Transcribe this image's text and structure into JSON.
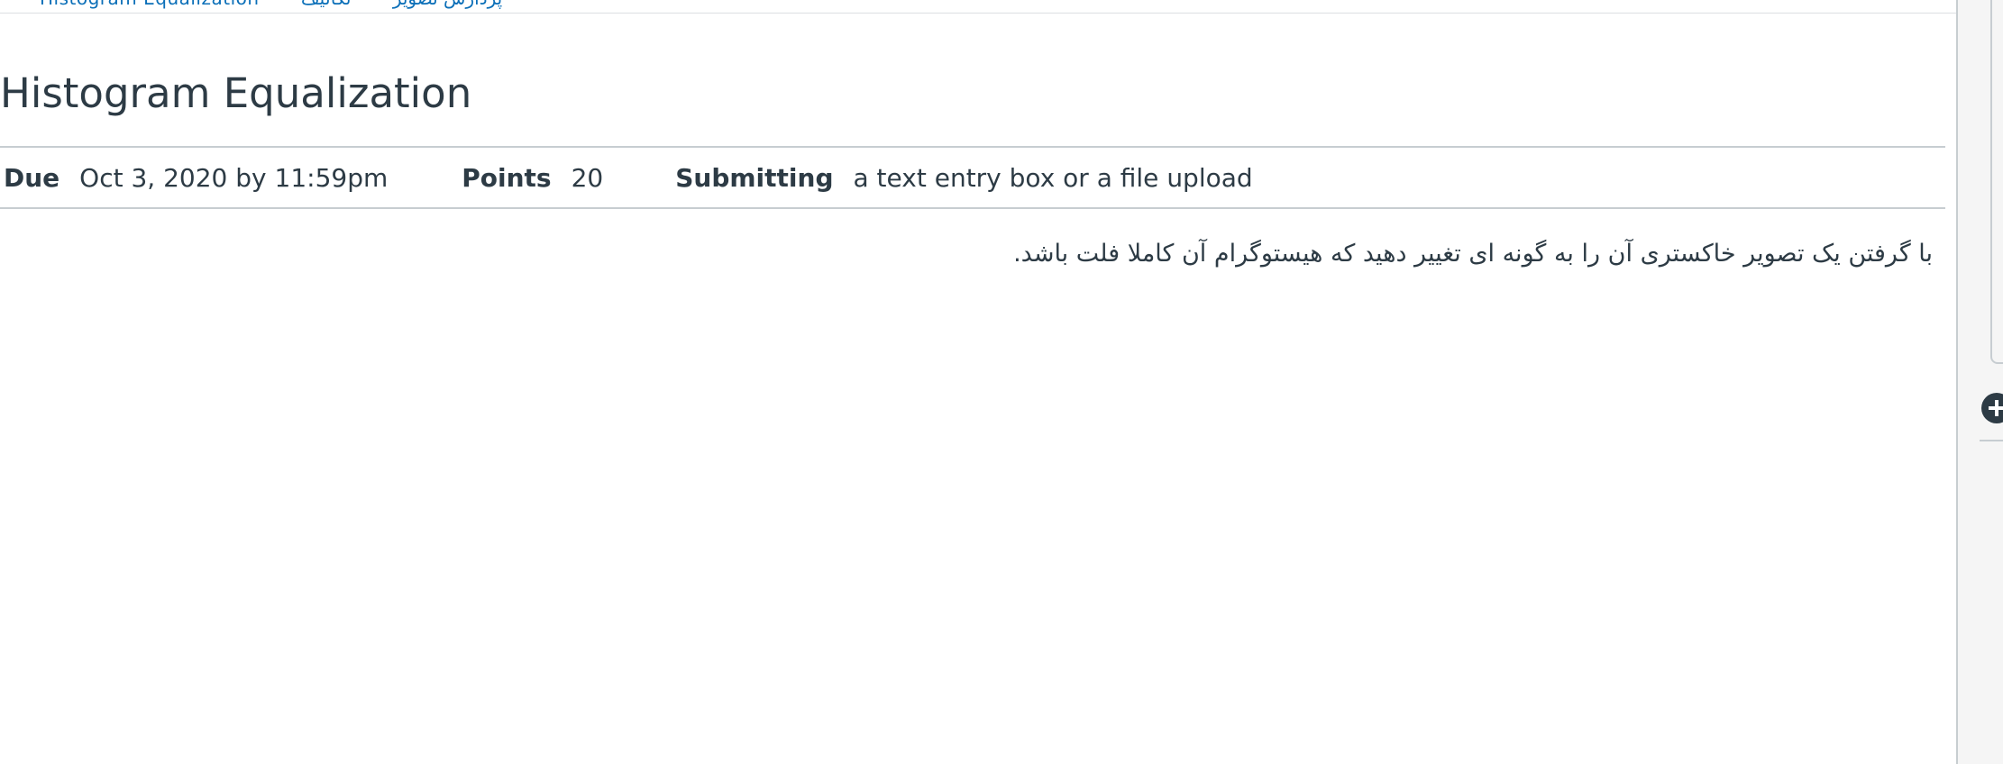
{
  "breadcrumb": {
    "items": [
      "پردازش تصویر",
      "تکالیف",
      "Histogram Equalization"
    ]
  },
  "assignment": {
    "title": "Histogram Equalization",
    "due_label": "Due",
    "due_value": "Oct 3, 2020 by 11:59pm",
    "points_label": "Points",
    "points_value": "20",
    "submitting_label": "Submitting",
    "submitting_value": "a text entry box or a file upload",
    "description": "با گرفتن یک تصویر خاکستری آن را به گونه ای تغییر دهید که هیستوگرام آن کاملا فلت باشد."
  },
  "side_panel": {
    "add_icon": "plus-circle-icon"
  },
  "colors": {
    "text": "#2d3b45",
    "link": "#0b6fb8",
    "rule": "#c7cdd1",
    "panel": "#f5f5f5"
  }
}
